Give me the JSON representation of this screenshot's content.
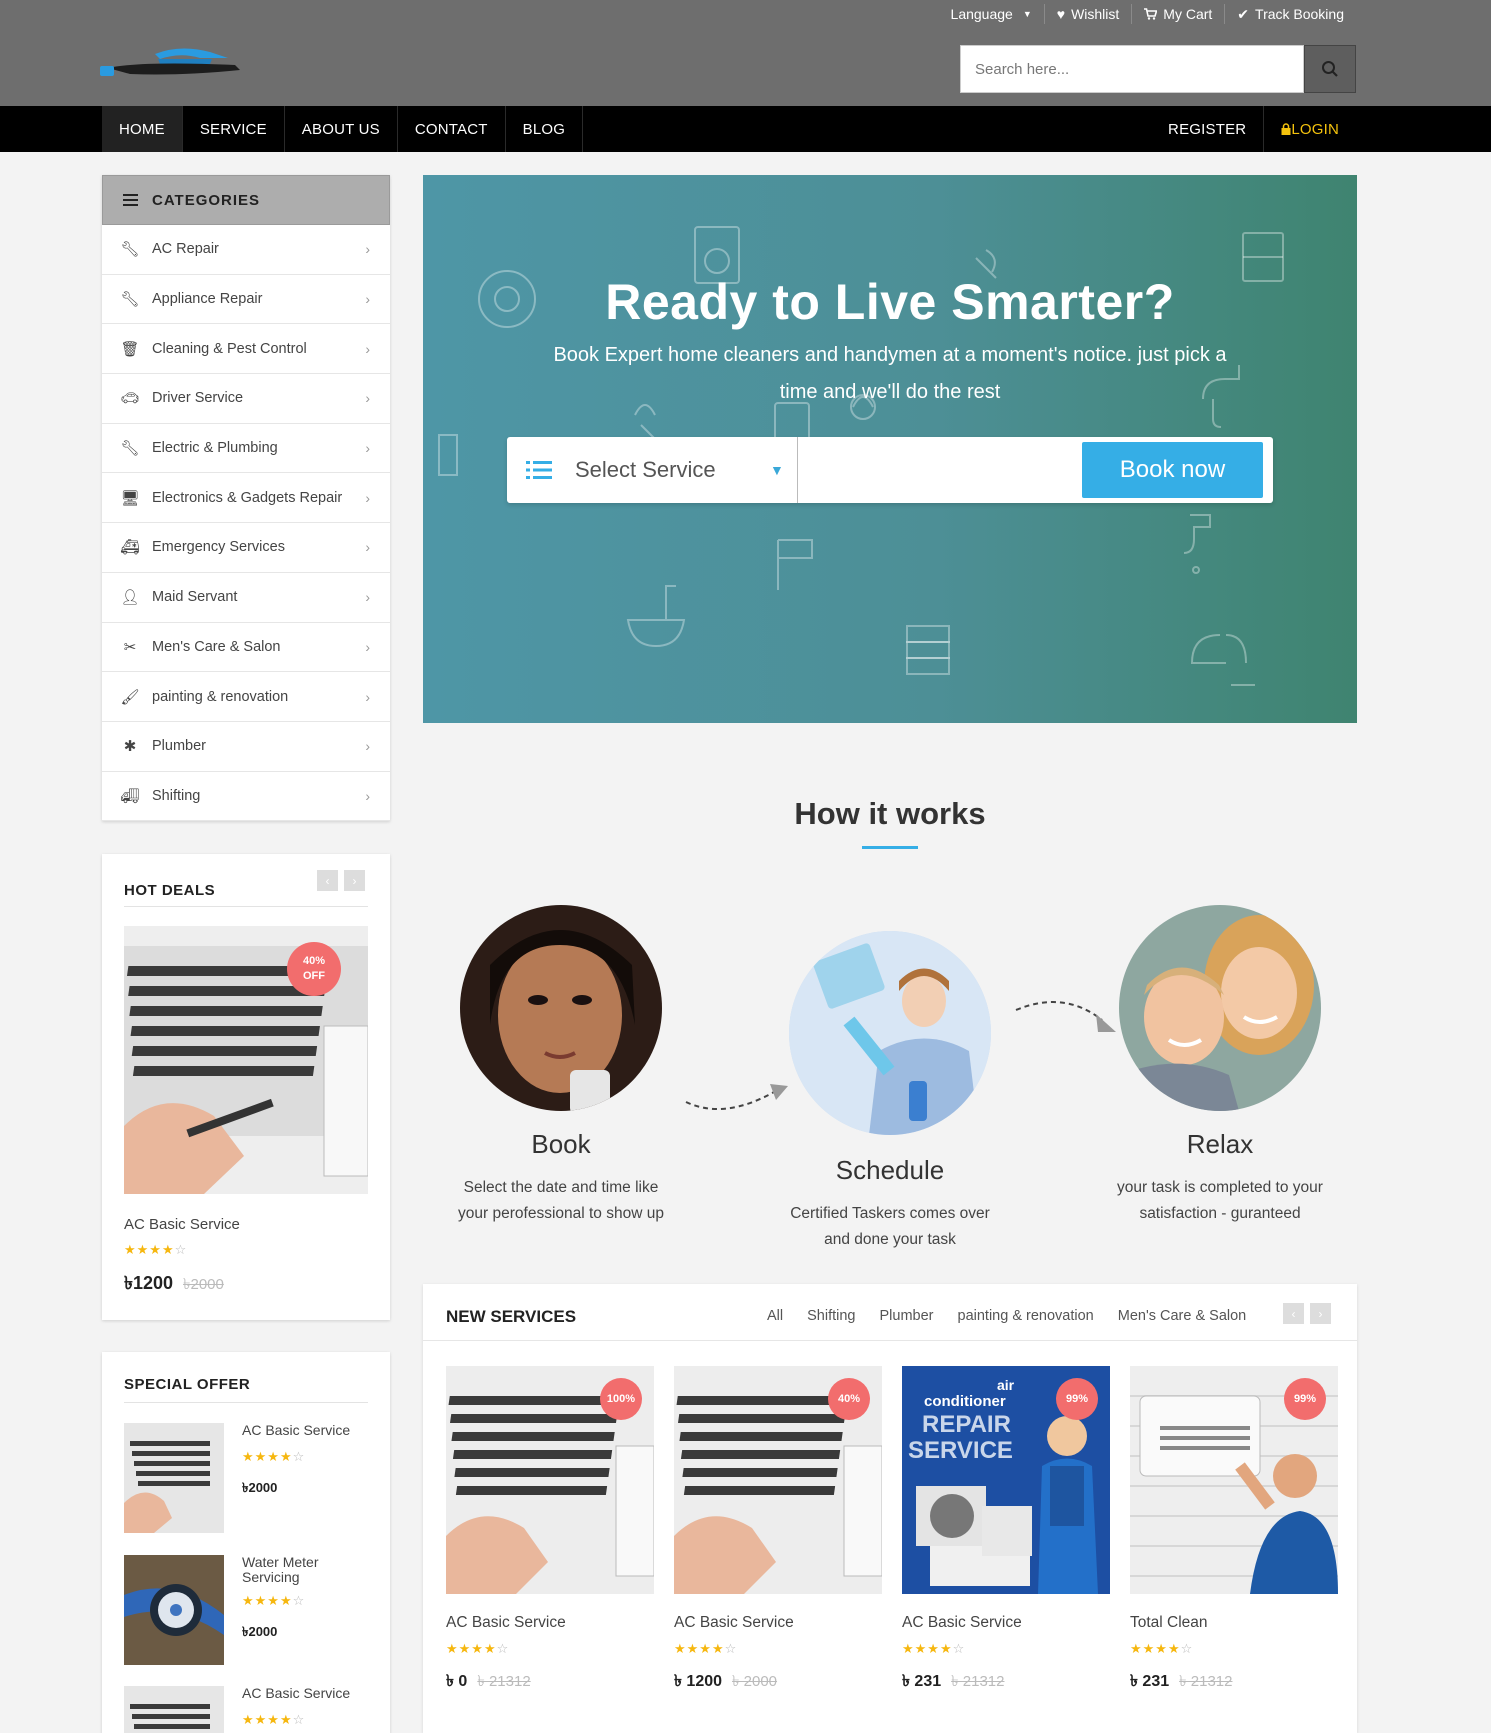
{
  "toplinks": {
    "language": "Language",
    "wishlist": "Wishlist",
    "cart": "My Cart",
    "track": "Track Booking"
  },
  "search": {
    "placeholder": "Search here..."
  },
  "nav": {
    "items": [
      "HOME",
      "SERVICE",
      "ABOUT US",
      "CONTACT",
      "BLOG"
    ],
    "register": "REGISTER",
    "login": "LOGIN"
  },
  "categories": {
    "title": "CATEGORIES",
    "items": [
      {
        "label": "AC Repair",
        "icon": "wrench-icon"
      },
      {
        "label": "Appliance Repair",
        "icon": "wrench-icon"
      },
      {
        "label": "Cleaning & Pest Control",
        "icon": "trash-icon"
      },
      {
        "label": "Driver Service",
        "icon": "car-icon"
      },
      {
        "label": "Electric & Plumbing",
        "icon": "wrench-icon"
      },
      {
        "label": "Electronics & Gadgets Repair",
        "icon": "desktop-icon"
      },
      {
        "label": "Emergency Services",
        "icon": "ambulance-icon"
      },
      {
        "label": "Maid Servant",
        "icon": "user-icon"
      },
      {
        "label": "Men's Care & Salon",
        "icon": "scissors-icon"
      },
      {
        "label": "painting & renovation",
        "icon": "brush-icon"
      },
      {
        "label": "Plumber",
        "icon": "asterisk-icon"
      },
      {
        "label": "Shifting",
        "icon": "truck-icon"
      }
    ]
  },
  "hot_deals": {
    "title": "HOT DEALS",
    "badge": "40%\nOFF",
    "name": "AC Basic Service",
    "rating": 4,
    "price": "৳1200",
    "old_price": "৳2000"
  },
  "special_offer": {
    "title": "SPECIAL OFFER",
    "items": [
      {
        "name": "AC Basic Service",
        "rating": 4,
        "price": "৳2000"
      },
      {
        "name": "Water Meter Servicing",
        "rating": 4,
        "price": "৳2000"
      },
      {
        "name": "AC Basic Service",
        "rating": 4,
        "price": ""
      }
    ]
  },
  "hero": {
    "title": "Ready to Live Smarter?",
    "subtitle": "Book Expert home cleaners and handymen at a moment's notice. just pick a time and we'll do the rest",
    "select_label": "Select Service",
    "book_button": "Book now"
  },
  "how_it_works": {
    "title": "How it works",
    "steps": [
      {
        "title": "Book",
        "desc": "Select the date and time like your perofessional to show up"
      },
      {
        "title": "Schedule",
        "desc": "Certified Taskers comes over and done your task"
      },
      {
        "title": "Relax",
        "desc": "your task is completed to your satisfaction - guranteed"
      }
    ]
  },
  "new_services": {
    "title": "NEW SERVICES",
    "filters": [
      "All",
      "Shifting",
      "Plumber",
      "painting & renovation",
      "Men's Care & Salon"
    ],
    "cards": [
      {
        "name": "AC Basic Service",
        "badge": "100%",
        "rating": 4,
        "price": "৳ 0",
        "old_price": "৳ 21312"
      },
      {
        "name": "AC Basic Service",
        "badge": "40%",
        "rating": 4,
        "price": "৳ 1200",
        "old_price": "৳ 2000"
      },
      {
        "name": "AC Basic Service",
        "badge": "99%",
        "rating": 4,
        "price": "৳ 231",
        "old_price": "৳ 21312"
      },
      {
        "name": "Total Clean",
        "badge": "99%",
        "rating": 4,
        "price": "৳ 231",
        "old_price": "৳ 21312"
      }
    ],
    "poster_text": {
      "line1": "air",
      "line2": "conditioner",
      "line3": "REPAIR",
      "line4": "SERVICE"
    }
  },
  "colors": {
    "topbar": "#6e6e6e",
    "nav": "#000000",
    "accent": "#35aee6",
    "badge": "#f26d6d",
    "star": "#f6b70f",
    "login": "#f4c20d"
  }
}
